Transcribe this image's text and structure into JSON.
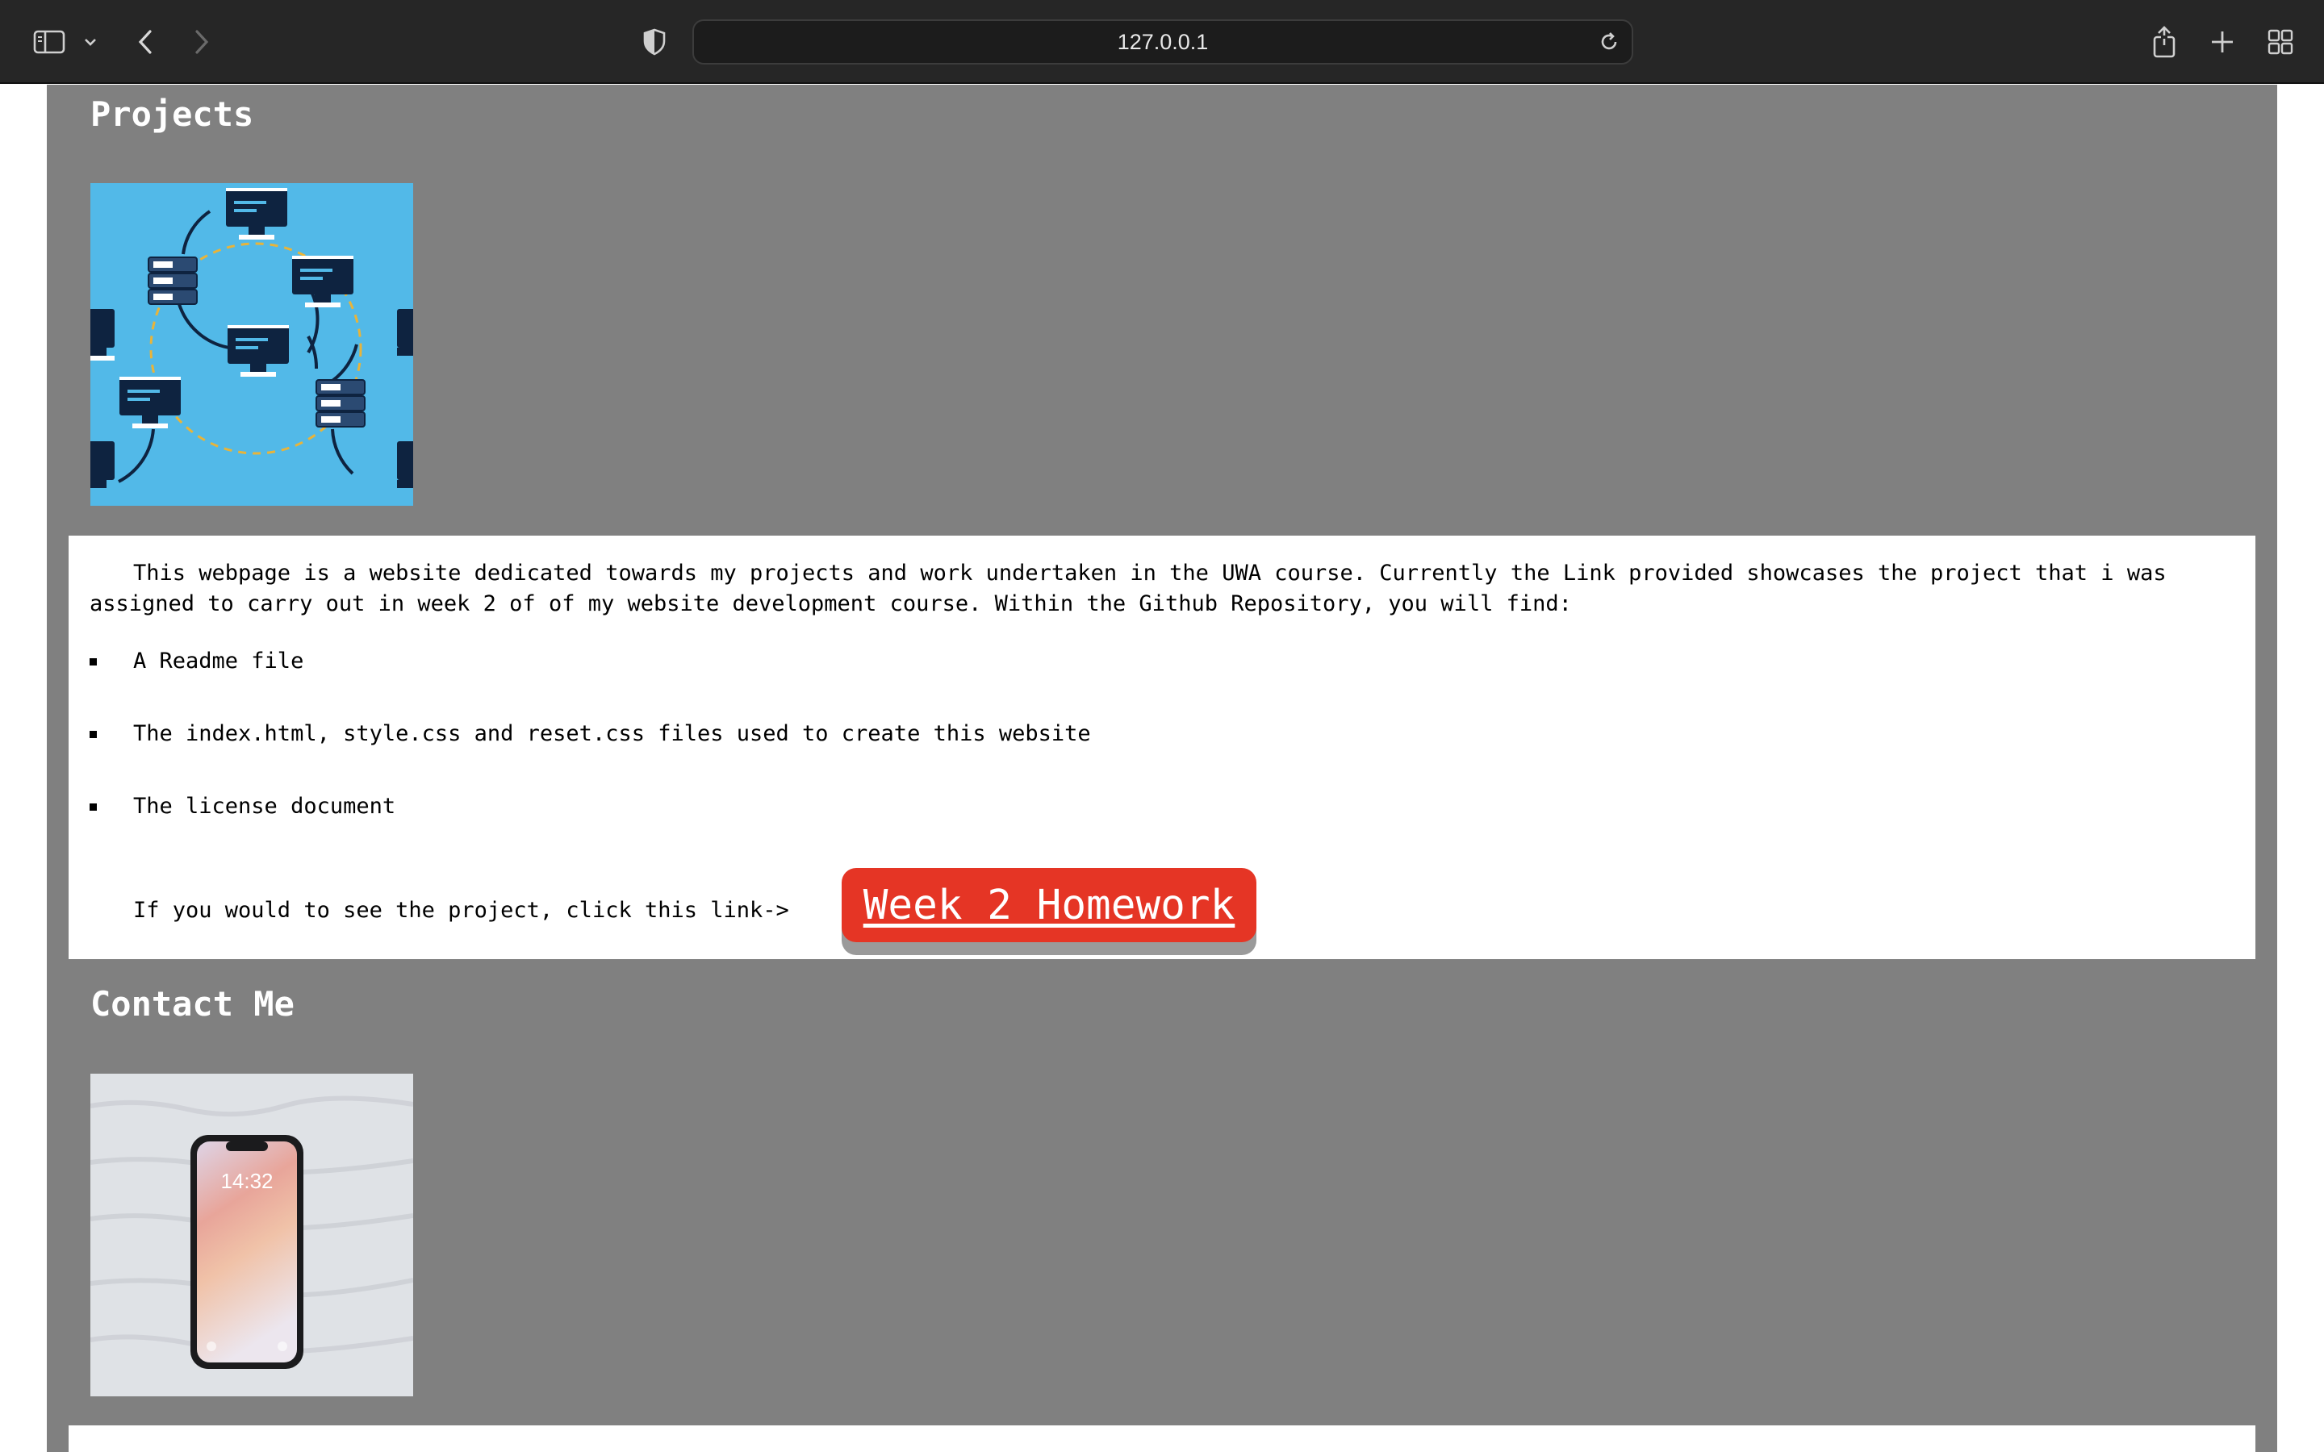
{
  "browser": {
    "url": "127.0.0.1",
    "icons": {
      "sidebar": "sidebar-icon",
      "back": "chevron-left-icon",
      "forward": "chevron-right-icon",
      "privacy": "shield-icon",
      "reload": "reload-icon",
      "share": "share-icon",
      "new_tab": "plus-icon",
      "tab_overview": "grid-icon"
    }
  },
  "projects": {
    "title": "Projects",
    "paragraph": "This webpage is a website dedicated towards my projects and work undertaken in the UWA course. Currently the Link provided showcases the project that i was assigned to carry out in week 2 of of my website development course. Within the Github Repository, you will find:",
    "items": [
      "A Readme file",
      "The index.html, style.css and reset.css files used to create this website",
      "The license document"
    ],
    "cta_text": "If you would to see the project, click this link->",
    "cta_button": "Week 2 Homework"
  },
  "contact": {
    "title": "Contact Me",
    "phone_time": "14:32"
  },
  "colors": {
    "page_background": "#808080",
    "card_background": "#ffffff",
    "button": "#e53525",
    "projects_image_bg": "#52b9e8"
  }
}
